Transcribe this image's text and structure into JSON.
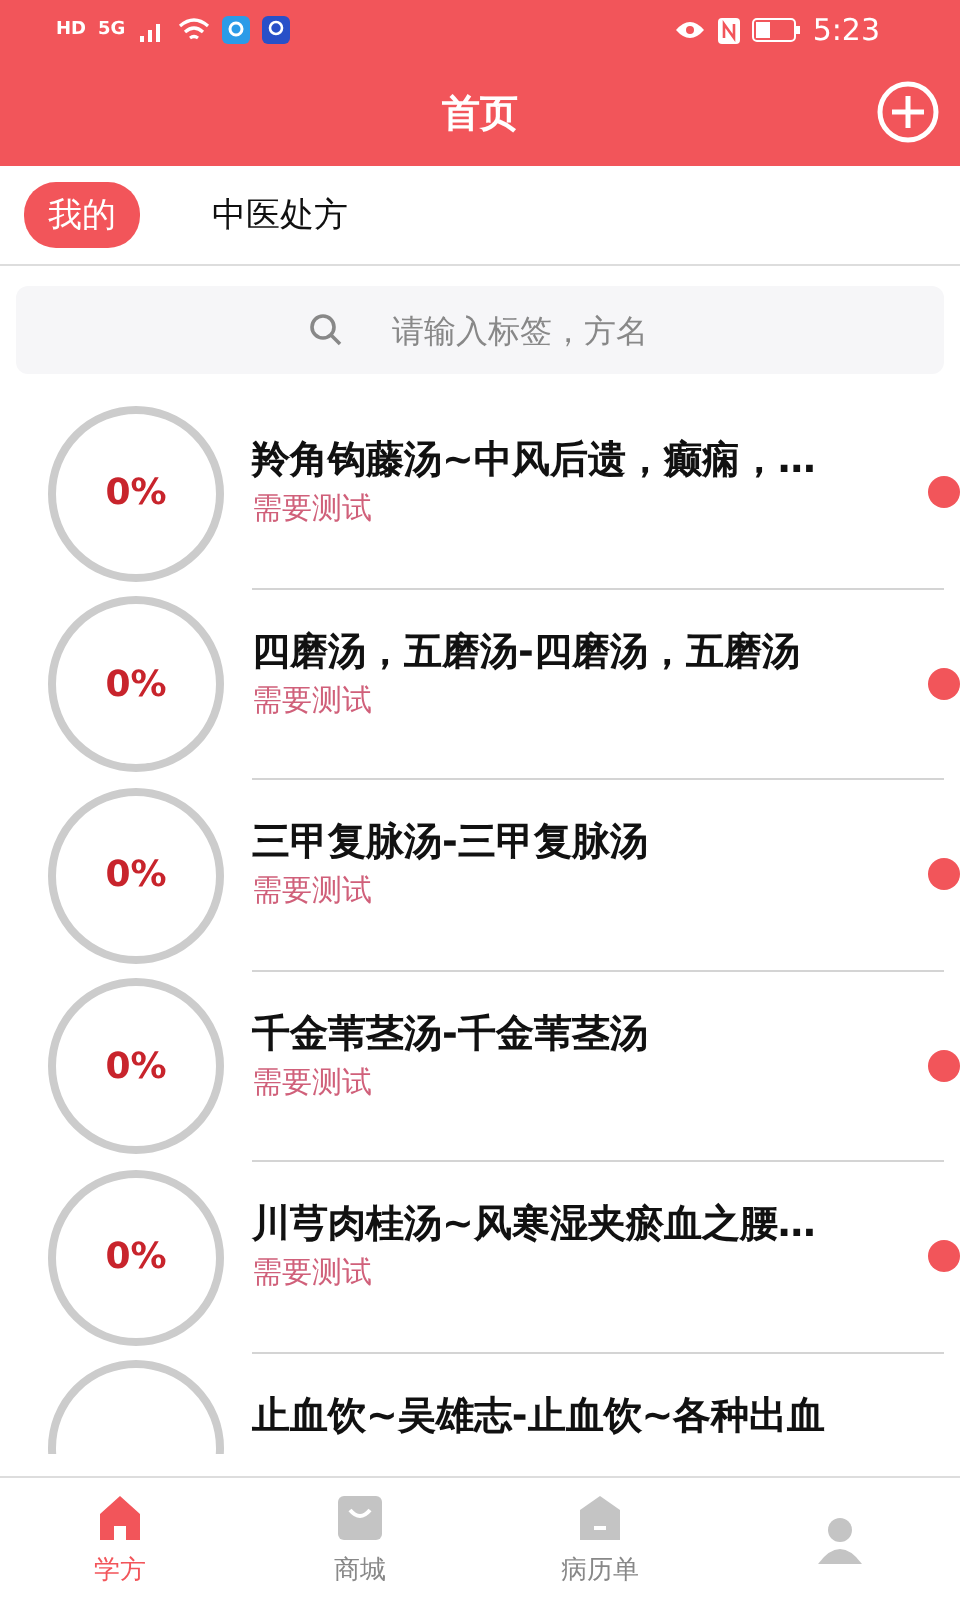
{
  "status_bar": {
    "hd": "HD",
    "network": "5G",
    "time": "5:23"
  },
  "header": {
    "title": "首页"
  },
  "tabs": [
    {
      "label": "我的",
      "selected": true
    },
    {
      "label": "中医处方",
      "selected": false
    }
  ],
  "search": {
    "placeholder": "请输入标签，方名"
  },
  "formulas": [
    {
      "progress": "0%",
      "title": "羚角钩藤汤~中风后遗，癫痫，…",
      "status": "需要测试",
      "unread": true
    },
    {
      "progress": "0%",
      "title": "四磨汤，五磨汤-四磨汤，五磨汤",
      "status": "需要测试",
      "unread": true
    },
    {
      "progress": "0%",
      "title": "三甲复脉汤-三甲复脉汤",
      "status": "需要测试",
      "unread": true
    },
    {
      "progress": "0%",
      "title": "千金苇茎汤-千金苇茎汤",
      "status": "需要测试",
      "unread": true
    },
    {
      "progress": "0%",
      "title": "川芎肉桂汤~风寒湿夹瘀血之腰…",
      "status": "需要测试",
      "unread": true
    },
    {
      "title": "止血饮~吴雄志-止血饮~各种出血",
      "unread": false
    }
  ],
  "bottom_nav": [
    {
      "kind": "home",
      "label": "学方",
      "selected": true
    },
    {
      "kind": "shop",
      "label": "商城",
      "selected": false
    },
    {
      "kind": "record",
      "label": "病历单",
      "selected": false
    },
    {
      "kind": "person",
      "selected": false
    }
  ]
}
